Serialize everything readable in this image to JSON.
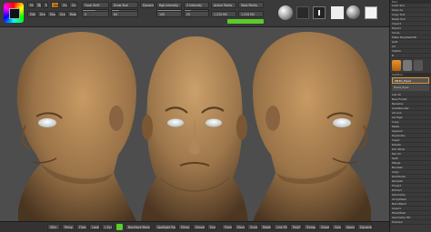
{
  "toolbar": {
    "row1": [
      "Mrgb",
      "Rgb",
      "M",
      "Zadd",
      "Zsub",
      "Zcut",
      "Focal Shift",
      "Draw Size",
      "Dynamic",
      "Rgb Intensity",
      "Z Intensity",
      "Active Points",
      "Total Points"
    ],
    "row2": [
      "Edit",
      "Draw",
      "Move",
      "Scale",
      "Rotate",
      "Perspective",
      "Floor",
      "Local",
      "Gizmo",
      "Solo"
    ],
    "values": {
      "focal_shift": "0",
      "draw_size": "64",
      "z_intensity": "25",
      "rgb_intensity": "100",
      "active_points": "1.234 Mil",
      "total_points": "1.234 Mil"
    },
    "icons": [
      "brush-sphere",
      "stroke-dots",
      "alpha-square",
      "texture-off",
      "material-sphere",
      "color-white"
    ]
  },
  "right_panel": {
    "header": "Tool",
    "items_top": [
      "Load Tool",
      "Save As",
      "Copy Tool",
      "Paste Tool",
      "Import",
      "Export",
      "Clone",
      "Make PolyMesh3D",
      "GoZ",
      "All",
      "Visible",
      "R"
    ],
    "subtool_header": "SubTool",
    "subtools": [
      "PM3D_Head",
      "Head_Eyes"
    ],
    "items_mid": [
      "List All",
      "New Folder",
      "Rename",
      "AutoReorder",
      "All Low",
      "All High",
      "Copy",
      "Paste",
      "Append",
      "Duplicate",
      "Insert",
      "Delete",
      "Del Other",
      "Del All",
      "Split",
      "Merge",
      "Boolean",
      "Align",
      "Distribute",
      "Remesh",
      "Project",
      "Extract"
    ],
    "items_bottom": [
      "Geometry",
      "ArrayMesh",
      "NanoMesh",
      "Layers",
      "FiberMesh",
      "Geometry HD",
      "Preview"
    ]
  },
  "bottom_bar": {
    "left": [
      "SDiv",
      "Persp",
      "Floor",
      "Local",
      "L.Sym"
    ],
    "right": [
      "Frame",
      "Move",
      "Scale",
      "Rotate",
      "Line Fill",
      "PolyF",
      "Transp",
      "Ghost",
      "Solo",
      "Xpose",
      "Dynamic"
    ],
    "center": "Backface Mask",
    "extras": [
      "Spotlight Radius",
      "Mirror",
      "Smooth",
      "Hue"
    ]
  },
  "colors": {
    "skin": "#a58156",
    "viewport": "#4d4d4d",
    "accent": "#e7952c",
    "toggle_on": "#5bcc2a"
  }
}
